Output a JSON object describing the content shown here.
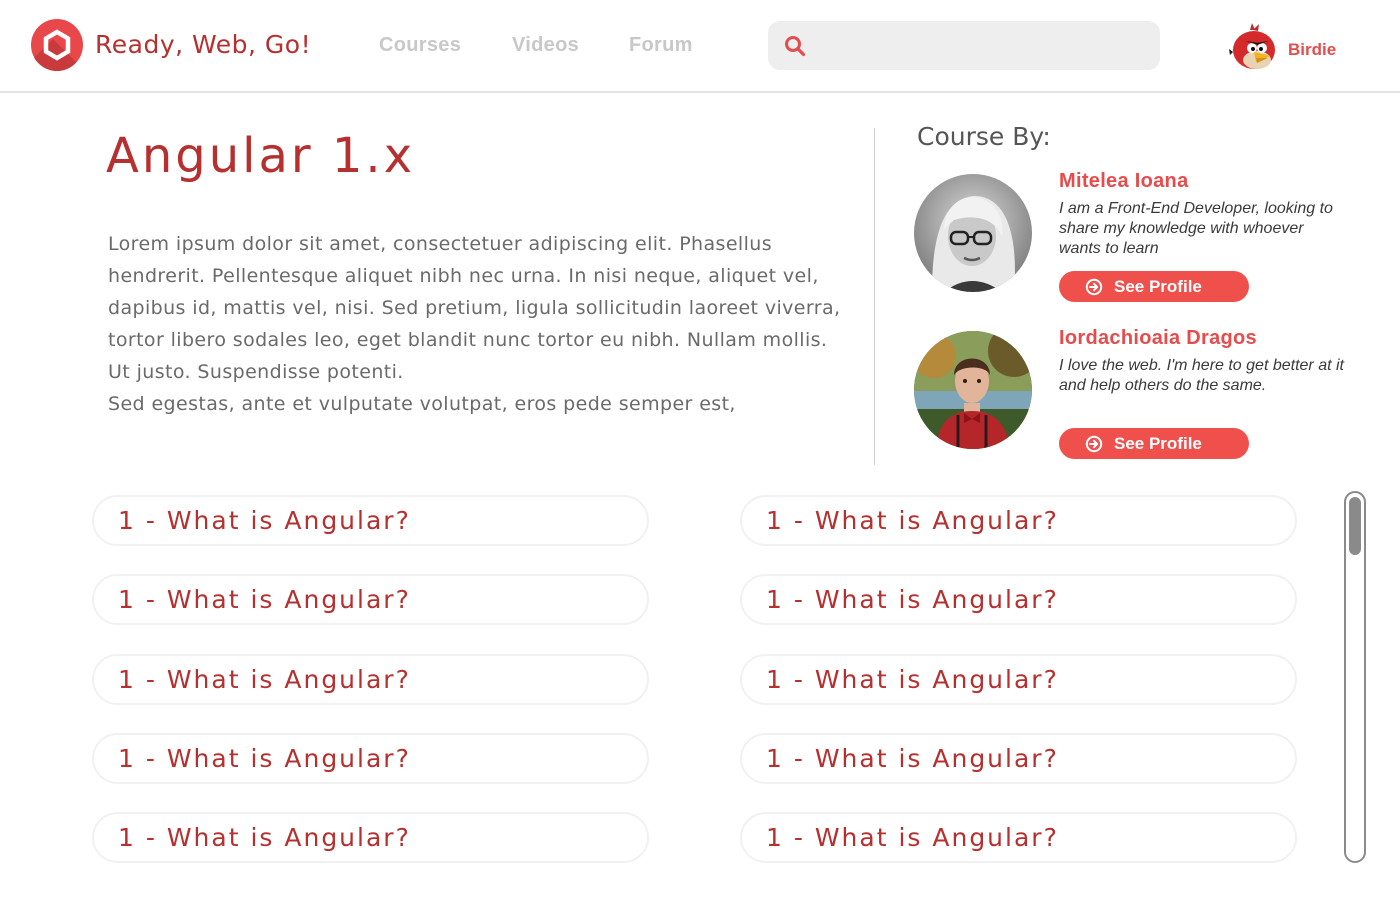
{
  "header": {
    "brand": "Ready, Web, Go!",
    "nav": [
      {
        "label": "Courses"
      },
      {
        "label": "Videos"
      },
      {
        "label": "Forum"
      }
    ],
    "search": {
      "value": "",
      "placeholder": "",
      "icon": "search-icon"
    },
    "user": {
      "name": "Birdie",
      "avatar_icon": "angry-bird-avatar"
    }
  },
  "course": {
    "title": "Angular 1.x",
    "description": "Lorem ipsum dolor sit amet, consectetuer adipiscing elit. Phasellus hendrerit. Pellentesque aliquet nibh nec urna. In nisi neque, aliquet vel, dapibus id, mattis vel, nisi. Sed pretium, ligula sollicitudin laoreet viverra, tortor libero sodales leo, eget blandit nunc tortor eu nibh. Nullam mollis. Ut justo. Suspendisse potenti.\nSed egestas, ante et vulputate volutpat, eros pede semper est,"
  },
  "authors_section": {
    "heading": "Course By:",
    "authors": [
      {
        "name": "Mitelea Ioana",
        "bio": "I am a Front-End Developer, looking to share my knowledge with whoever wants to learn",
        "button": "See Profile"
      },
      {
        "name": "Iordachioaia Dragos",
        "bio": "I love the web. I'm here to get better at it and help others do the same.",
        "button": "See Profile"
      }
    ]
  },
  "lessons": {
    "left": [
      "1 - What is Angular?",
      "1 - What is Angular?",
      "1 - What is Angular?",
      "1 - What is Angular?",
      "1 - What is Angular?"
    ],
    "right": [
      "1 - What is Angular?",
      "1 - What is Angular?",
      "1 - What is Angular?",
      "1 - What is Angular?",
      "1 - What is Angular?"
    ]
  },
  "colors": {
    "brand_red": "#b5302f",
    "accent_red": "#e74c4c",
    "button_red": "#f0504c",
    "nav_gray": "#c8c8c8"
  }
}
